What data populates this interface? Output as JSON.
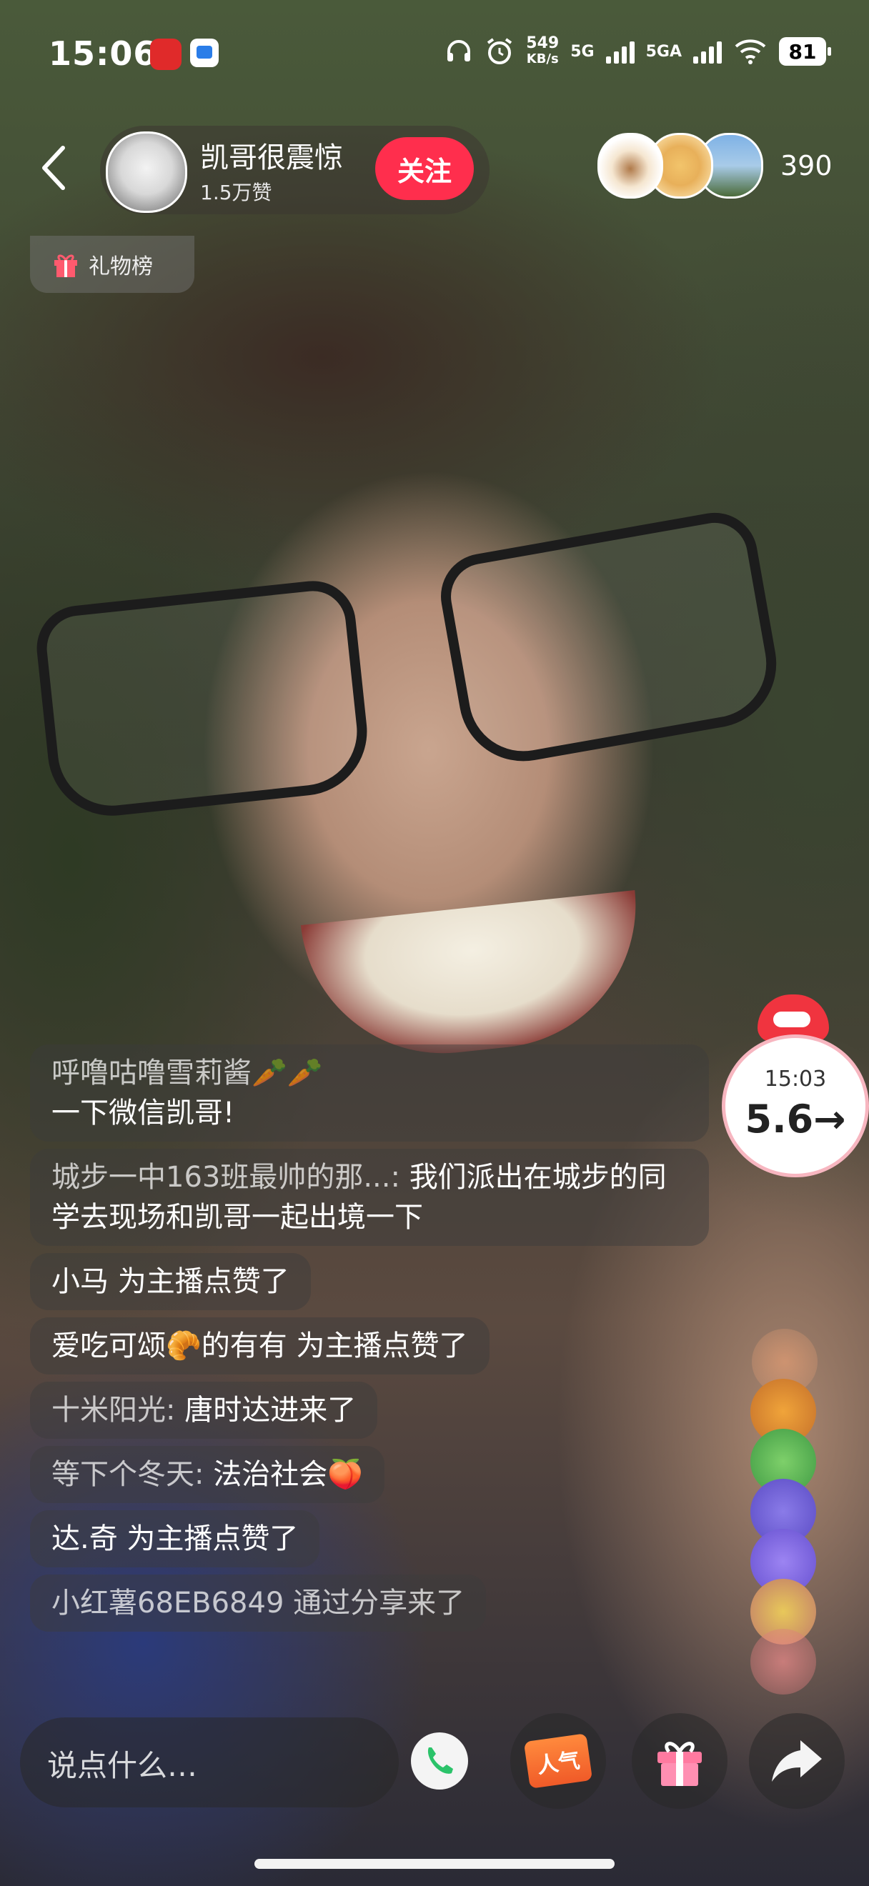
{
  "status_bar": {
    "time": "15:06",
    "net_speed_value": "549",
    "net_speed_unit": "KB/s",
    "sig1_label": "5G",
    "sig2_label": "5GA",
    "battery": "81"
  },
  "header": {
    "host_name": "凯哥很震惊",
    "host_likes": "1.5万赞",
    "follow_label": "关注",
    "viewer_count": "390"
  },
  "rank": {
    "gift_rank_label": "礼物榜"
  },
  "chat": {
    "messages": [
      {
        "user": "呼噜咕噜雪莉酱🥕🥕",
        "text": "一下微信凯哥!"
      },
      {
        "user": "城步一中163班最帅的那...: ",
        "text": "我们派出在城步的同学去现场和凯哥一起出境一下"
      },
      {
        "user": "小马 为主播点赞了",
        "text": ""
      },
      {
        "user": "爱吃可颂🥐的有有 为主播点赞了",
        "text": ""
      },
      {
        "user": "十米阳光: ",
        "text": "唐时达进来了"
      },
      {
        "user": "等下个冬天: ",
        "text": "法治社会🍑"
      },
      {
        "user": "达.奇 为主播点赞了",
        "text": ""
      },
      {
        "user": "小红薯68EB6849 通过分享来了",
        "text": ""
      }
    ]
  },
  "timer": {
    "time": "15:03",
    "value": "5.6→"
  },
  "bottom_bar": {
    "input_placeholder": "说点什么…",
    "popularity_label": "人气"
  },
  "colors": {
    "follow_red": "#ff2e4d",
    "chat_bubble": "rgba(60,60,60,0.45)"
  }
}
